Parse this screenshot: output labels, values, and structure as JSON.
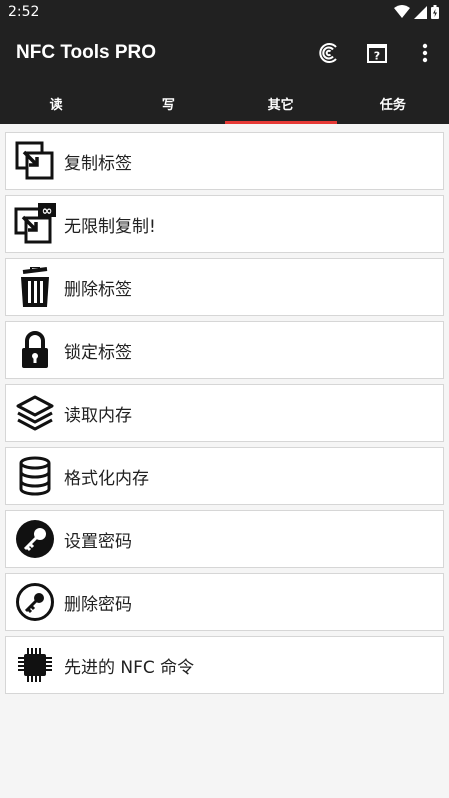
{
  "status": {
    "time": "2:52"
  },
  "app": {
    "title": "NFC Tools PRO"
  },
  "tabs": [
    {
      "label": "读",
      "active": false
    },
    {
      "label": "写",
      "active": false
    },
    {
      "label": "其它",
      "active": true
    },
    {
      "label": "任务",
      "active": false
    }
  ],
  "items": [
    {
      "label": "复制标签",
      "icon": "copy-tag-icon"
    },
    {
      "label": "无限制复制!",
      "icon": "unlimited-copy-icon"
    },
    {
      "label": "删除标签",
      "icon": "trash-icon"
    },
    {
      "label": "锁定标签",
      "icon": "lock-icon"
    },
    {
      "label": "读取内存",
      "icon": "layers-icon"
    },
    {
      "label": "格式化内存",
      "icon": "database-icon"
    },
    {
      "label": "设置密码",
      "icon": "key-icon"
    },
    {
      "label": "删除密码",
      "icon": "key-outline-icon"
    },
    {
      "label": "先进的 NFC 命令",
      "icon": "chip-icon"
    }
  ],
  "colors": {
    "appbar": "#212121",
    "tab_indicator": "#e53935",
    "background": "#f5f5f5"
  }
}
